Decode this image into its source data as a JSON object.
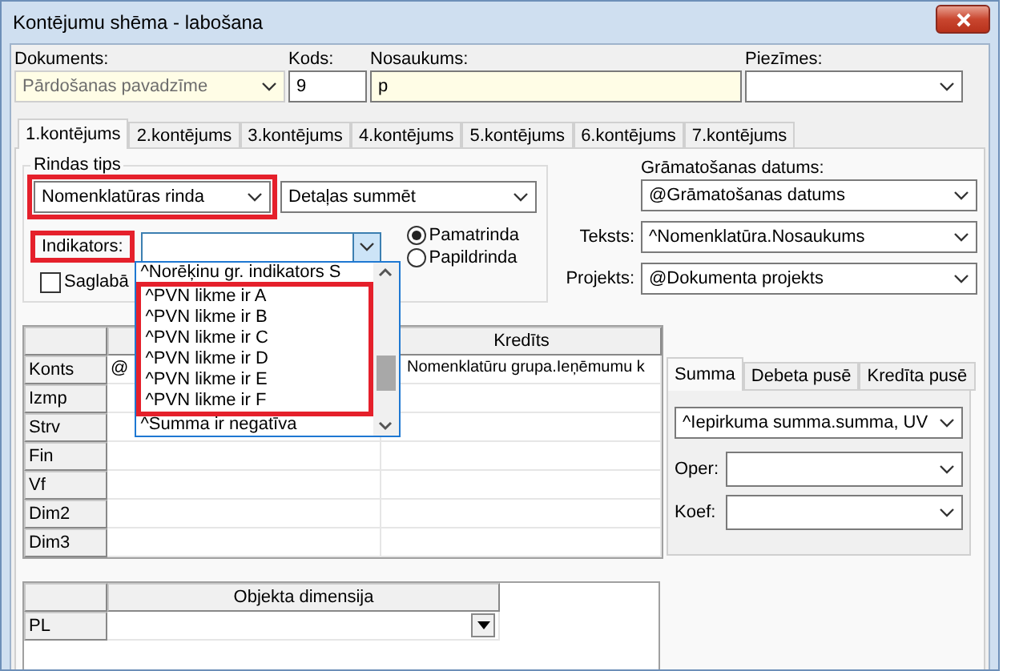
{
  "window": {
    "title": "Kontējumu shēma - labošana"
  },
  "header_fields": [
    {
      "label": "Dokuments:",
      "value": "Pārdošanas pavadzīme",
      "kind": "combo",
      "disabled": true,
      "required": true
    },
    {
      "label": "Kods:",
      "value": "9",
      "kind": "text",
      "disabled": false,
      "required": false
    },
    {
      "label": "Nosaukums:",
      "value": "p",
      "kind": "text",
      "disabled": false,
      "required": true
    },
    {
      "label": "Piezīmes:",
      "kind": "combo",
      "disabled": false,
      "required": false
    }
  ],
  "tabs": [
    {
      "label": "1.kontējums",
      "selected": true
    },
    {
      "label": "2.kontējums",
      "selected": false
    },
    {
      "label": "3.kontējums",
      "selected": false
    },
    {
      "label": "4.kontējums",
      "selected": false
    },
    {
      "label": "5.kontējums",
      "selected": false
    },
    {
      "label": "6.kontējums",
      "selected": false
    },
    {
      "label": "7.kontējums",
      "selected": false
    }
  ],
  "rindas_tips": {
    "title": "Rindas tips",
    "type": {
      "value": "Nomenklatūras rinda",
      "highlighted": true
    },
    "summing": {
      "value": "Detaļas summēt"
    },
    "indikators": {
      "label": "Indikators:",
      "highlighted": true,
      "open": true,
      "options": [
        {
          "label": "^Norēķinu gr. indikators S",
          "highlighted": false
        },
        {
          "label": "^PVN likme ir A",
          "highlighted": true
        },
        {
          "label": "^PVN likme ir B",
          "highlighted": true
        },
        {
          "label": "^PVN likme ir C",
          "highlighted": true
        },
        {
          "label": "^PVN likme ir D",
          "highlighted": true
        },
        {
          "label": "^PVN likme ir E",
          "highlighted": true
        },
        {
          "label": "^PVN likme ir F",
          "highlighted": true
        },
        {
          "label": "^Summa ir negatīva",
          "highlighted": false
        }
      ]
    },
    "row_kind": [
      {
        "label": "Pamatrinda",
        "selected": true
      },
      {
        "label": "Papildrinda",
        "selected": false
      }
    ],
    "keep": {
      "label": "Saglabā",
      "checked": false
    }
  },
  "right_fields": [
    {
      "label": "Grāmatošanas datums:",
      "value": "@Grāmatošanas datums",
      "kind": "stacked"
    },
    {
      "label": "Teksts:",
      "value": "^Nomenklatūra.Nosaukums",
      "kind": "inline"
    },
    {
      "label": "Projekts:",
      "value": "@Dokumenta projekts",
      "kind": "inline"
    }
  ],
  "grid": {
    "credit_header": "Kredīts",
    "rows": [
      {
        "label": "Konts",
        "cells": [
          "@",
          "Nomenklatūru grupa.Ieņēmumu k"
        ]
      },
      {
        "label": "Izmp"
      },
      {
        "label": "Strv"
      },
      {
        "label": "Fin"
      },
      {
        "label": "Vf"
      },
      {
        "label": "Dim2"
      },
      {
        "label": "Dim3"
      }
    ]
  },
  "amount_tabs": [
    {
      "label": "Summa",
      "selected": true
    },
    {
      "label": "Debeta pusē",
      "selected": false
    },
    {
      "label": "Kredīta pusē",
      "selected": false
    }
  ],
  "amount": {
    "value": "^Iepirkuma summa.summa, UV",
    "fields": [
      {
        "label": "Oper:"
      },
      {
        "label": "Koef:"
      }
    ]
  },
  "dimension_grid": {
    "header": "Objekta dimensija",
    "rows": [
      {
        "label": "PL"
      }
    ]
  }
}
